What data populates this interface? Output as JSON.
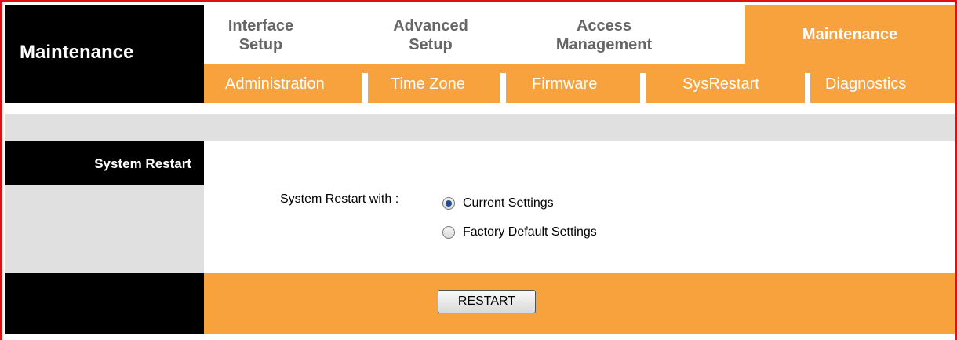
{
  "brand": {
    "title": "Maintenance"
  },
  "tabs": [
    {
      "line1": "Interface",
      "line2": "Setup"
    },
    {
      "line1": "Advanced",
      "line2": "Setup"
    },
    {
      "line1": "Access",
      "line2": "Management"
    },
    {
      "line1": "Maintenance",
      "line2": ""
    }
  ],
  "subnav": [
    "Administration",
    "Time Zone",
    "Firmware",
    "SysRestart",
    "Diagnostics"
  ],
  "section": {
    "title": "System Restart"
  },
  "restart": {
    "label": "System Restart with :",
    "options": [
      "Current Settings",
      "Factory Default Settings"
    ],
    "selected": "Current Settings"
  },
  "button": {
    "label": "RESTART"
  },
  "colors": {
    "accent": "#f7a23c",
    "border": "#e01010",
    "black": "#000000",
    "gray": "#e0e0e0"
  }
}
